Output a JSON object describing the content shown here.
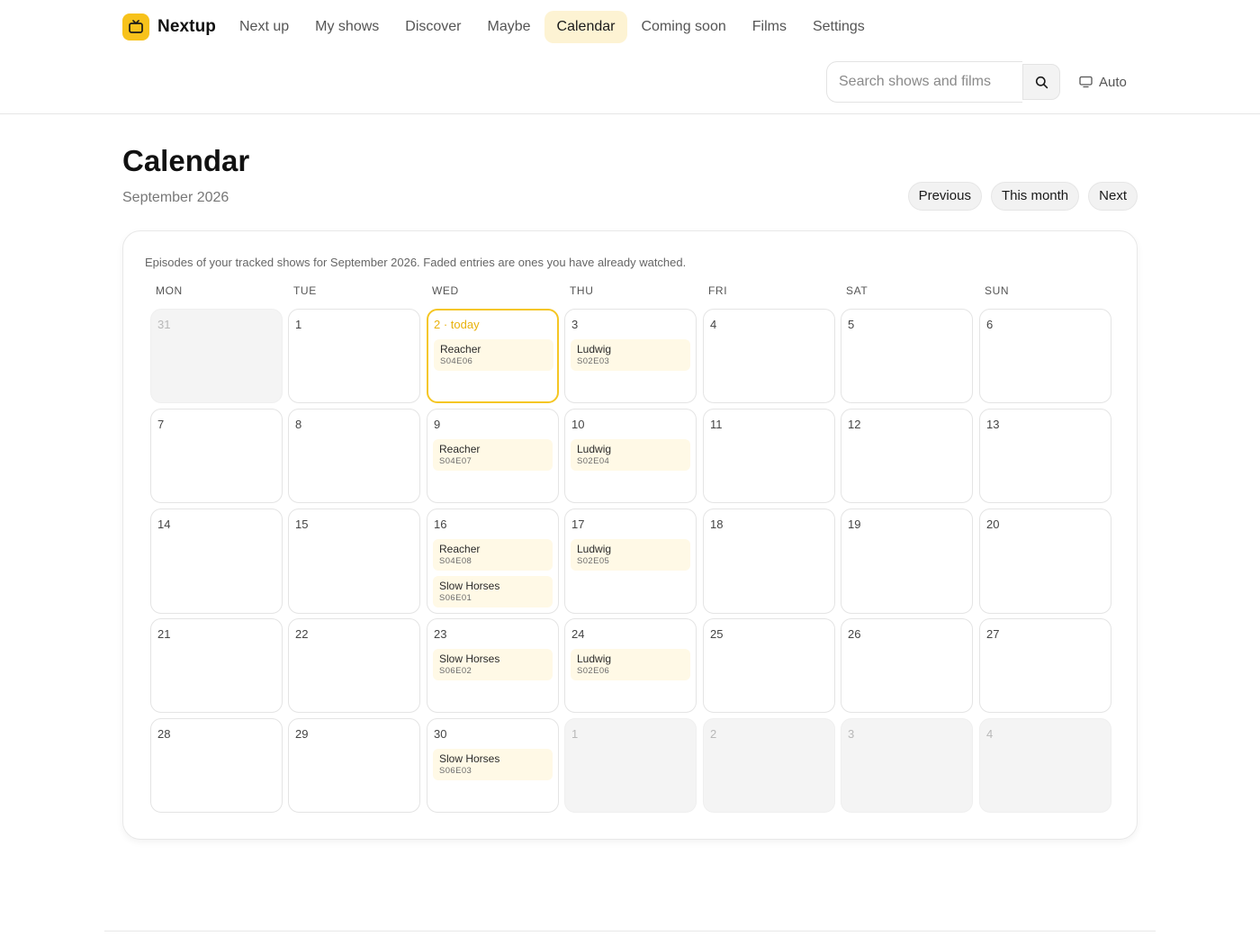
{
  "app": {
    "name": "Nextup",
    "accent": "#f7c21b",
    "logo_icon": "tv-icon"
  },
  "nav": [
    {
      "label": "Next up",
      "active": false
    },
    {
      "label": "My shows",
      "active": false
    },
    {
      "label": "Discover",
      "active": false
    },
    {
      "label": "Maybe",
      "active": false
    },
    {
      "label": "Calendar",
      "active": true
    },
    {
      "label": "Coming soon",
      "active": false
    },
    {
      "label": "Films",
      "active": false
    },
    {
      "label": "Settings",
      "active": false
    }
  ],
  "search": {
    "placeholder": "Search shows and films",
    "value": "",
    "icon": "search-icon"
  },
  "theme": {
    "label": "Auto",
    "icon": "monitor-icon"
  },
  "page": {
    "title": "Calendar",
    "subtitle": "September 2026"
  },
  "pager": {
    "previous": "Previous",
    "this_month": "This month",
    "next": "Next"
  },
  "calendar": {
    "note": "Episodes of your tracked shows for September 2026. Faded entries are ones you have already watched.",
    "weekdays": [
      "MON",
      "TUE",
      "WED",
      "THU",
      "FRI",
      "SAT",
      "SUN"
    ],
    "weeks": [
      [
        {
          "label": "31",
          "outside": true,
          "episodes": []
        },
        {
          "label": "1",
          "episodes": []
        },
        {
          "label": "2 · today",
          "today": true,
          "episodes": [
            {
              "show": "Reacher",
              "code": "S04E06"
            }
          ]
        },
        {
          "label": "3",
          "episodes": [
            {
              "show": "Ludwig",
              "code": "S02E03"
            }
          ]
        },
        {
          "label": "4",
          "episodes": []
        },
        {
          "label": "5",
          "episodes": []
        },
        {
          "label": "6",
          "episodes": []
        }
      ],
      [
        {
          "label": "7",
          "episodes": []
        },
        {
          "label": "8",
          "episodes": []
        },
        {
          "label": "9",
          "episodes": [
            {
              "show": "Reacher",
              "code": "S04E07"
            }
          ]
        },
        {
          "label": "10",
          "episodes": [
            {
              "show": "Ludwig",
              "code": "S02E04"
            }
          ]
        },
        {
          "label": "11",
          "episodes": []
        },
        {
          "label": "12",
          "episodes": []
        },
        {
          "label": "13",
          "episodes": []
        }
      ],
      [
        {
          "label": "14",
          "episodes": []
        },
        {
          "label": "15",
          "episodes": []
        },
        {
          "label": "16",
          "episodes": [
            {
              "show": "Reacher",
              "code": "S04E08"
            },
            {
              "show": "Slow Horses",
              "code": "S06E01"
            }
          ]
        },
        {
          "label": "17",
          "episodes": [
            {
              "show": "Ludwig",
              "code": "S02E05"
            }
          ]
        },
        {
          "label": "18",
          "episodes": []
        },
        {
          "label": "19",
          "episodes": []
        },
        {
          "label": "20",
          "episodes": []
        }
      ],
      [
        {
          "label": "21",
          "episodes": []
        },
        {
          "label": "22",
          "episodes": []
        },
        {
          "label": "23",
          "episodes": [
            {
              "show": "Slow Horses",
              "code": "S06E02"
            }
          ]
        },
        {
          "label": "24",
          "episodes": [
            {
              "show": "Ludwig",
              "code": "S02E06"
            }
          ]
        },
        {
          "label": "25",
          "episodes": []
        },
        {
          "label": "26",
          "episodes": []
        },
        {
          "label": "27",
          "episodes": []
        }
      ],
      [
        {
          "label": "28",
          "episodes": []
        },
        {
          "label": "29",
          "episodes": []
        },
        {
          "label": "30",
          "episodes": [
            {
              "show": "Slow Horses",
              "code": "S06E03"
            }
          ]
        },
        {
          "label": "1",
          "outside": true,
          "episodes": []
        },
        {
          "label": "2",
          "outside": true,
          "episodes": []
        },
        {
          "label": "3",
          "outside": true,
          "episodes": []
        },
        {
          "label": "4",
          "outside": true,
          "episodes": []
        }
      ]
    ]
  }
}
